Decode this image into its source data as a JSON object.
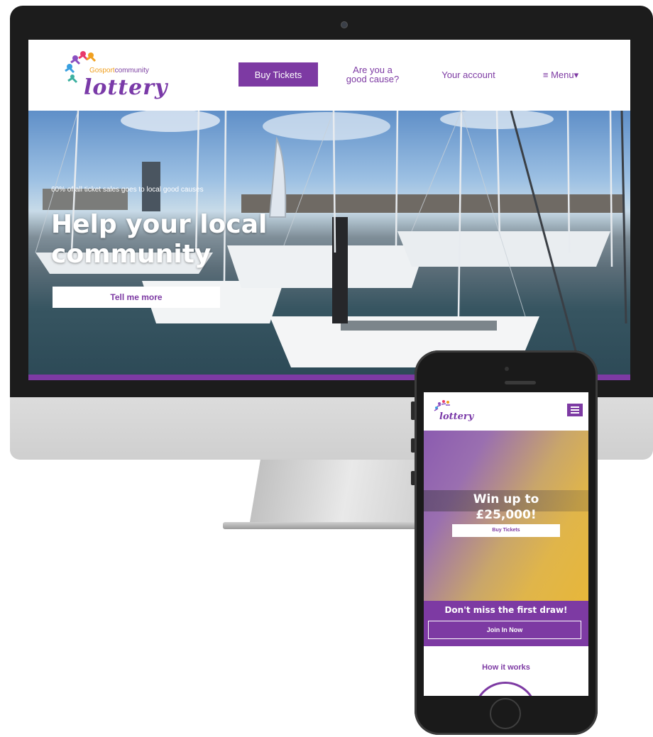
{
  "desktop": {
    "logo": {
      "brand_prefix": "Gosport",
      "brand_suffix": "community",
      "word": "lottery"
    },
    "nav": {
      "buy_tickets": "Buy Tickets",
      "good_cause_line1": "Are you a",
      "good_cause_line2": "good cause?",
      "your_account": "Your account",
      "menu": "Menu"
    },
    "hero": {
      "note": "60% of all ticket sales goes to local good causes",
      "title_line1": "Help your local",
      "title_line2": "community",
      "cta": "Tell me more"
    }
  },
  "mobile": {
    "logo_word": "lottery",
    "hero": {
      "win_line1": "Win up to",
      "win_line2": "£25,000!",
      "buy_tickets": "Buy Tickets"
    },
    "banner": {
      "headline": "Don't miss the first draw!",
      "cta": "Join In Now"
    },
    "how_it_works": "How it works"
  },
  "colors": {
    "brand_purple": "#7d3aa3",
    "accent_orange": "#f0a020"
  },
  "icons": {
    "menu": "hamburger-icon",
    "logo_mark": "colorful-figures-logo"
  }
}
